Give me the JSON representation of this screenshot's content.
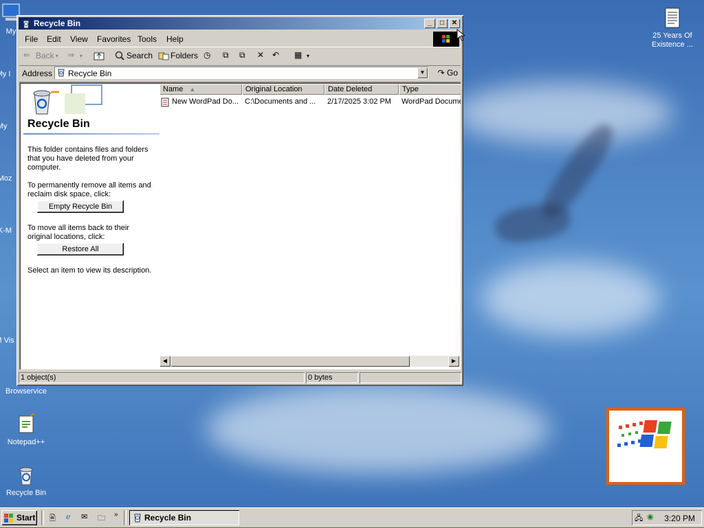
{
  "desktop": {
    "icons": [
      {
        "label": "My"
      },
      {
        "label": "My I"
      },
      {
        "label": "My"
      },
      {
        "label": "Moz"
      },
      {
        "label": "K-M"
      },
      {
        "label": "M Vis"
      },
      {
        "label": "Browservice"
      },
      {
        "label": "Notepad++"
      },
      {
        "label": "Recycle Bin"
      },
      {
        "label": "25 Years Of Existence ..."
      }
    ]
  },
  "window": {
    "title": "Recycle Bin",
    "menu": [
      "File",
      "Edit",
      "View",
      "Favorites",
      "Tools",
      "Help"
    ],
    "toolbar": {
      "back": "Back",
      "search": "Search",
      "folders": "Folders"
    },
    "address": {
      "label": "Address",
      "value": "Recycle Bin",
      "go": "Go"
    },
    "left_pane": {
      "title": "Recycle Bin",
      "description": "This folder contains files and folders that you have deleted from your computer.",
      "empty_prompt": "To permanently remove all items and reclaim disk space, click:",
      "empty_button": "Empty Recycle Bin",
      "restore_prompt": "To move all items back to their original locations, click:",
      "restore_button": "Restore All",
      "hint": "Select an item to view its description."
    },
    "columns": [
      "Name",
      "Original Location",
      "Date Deleted",
      "Type"
    ],
    "rows": [
      {
        "name": "New WordPad Do...",
        "location": "C:\\Documents and ...",
        "date": "2/17/2025 3:02 PM",
        "type": "WordPad Docume"
      }
    ],
    "status": {
      "objects": "1 object(s)",
      "size": "0 bytes"
    }
  },
  "taskbar": {
    "start": "Start",
    "task": "Recycle Bin",
    "clock": "3:20 PM"
  },
  "colors": {
    "title_start": "#0a246a",
    "title_end": "#a6caf0",
    "face": "#d4d0c8"
  }
}
